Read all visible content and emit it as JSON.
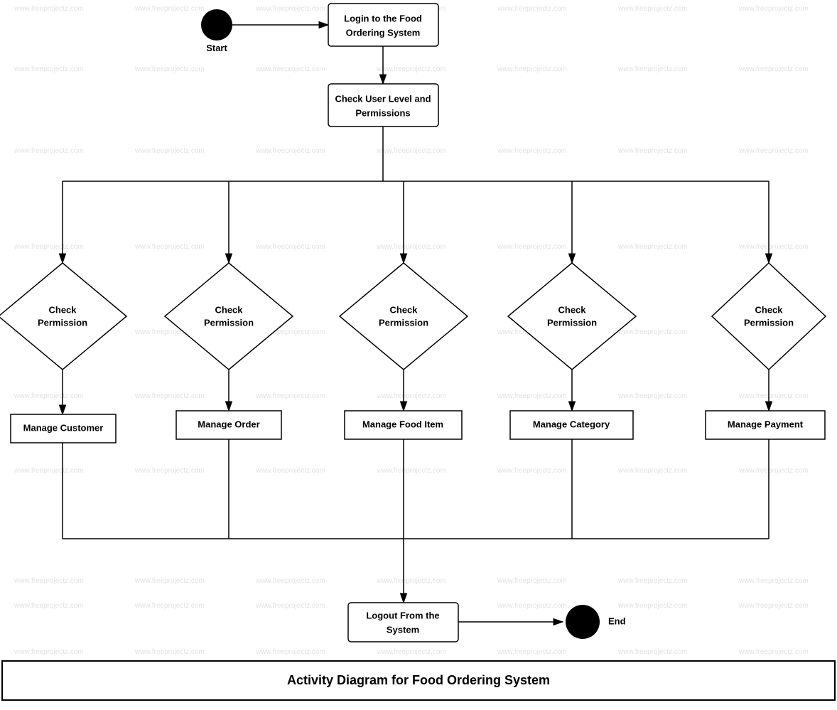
{
  "diagram": {
    "title": "Activity Diagram for Food Ordering System",
    "nodes": {
      "start": {
        "label": "Start"
      },
      "login": {
        "label": "Login to the Food\nOrdering System"
      },
      "checkPermissions": {
        "label": "Check User Level and\nPermissions"
      },
      "checkPerm1": {
        "label": "Check\nPermission"
      },
      "checkPerm2": {
        "label": "Check\nPermission"
      },
      "checkPerm3": {
        "label": "Check\nPermission"
      },
      "checkPerm4": {
        "label": "Check\nPermission"
      },
      "checkPerm5": {
        "label": "Check\nPermission"
      },
      "manageCustomer": {
        "label": "Manage Customer"
      },
      "manageOrder": {
        "label": "Manage Order"
      },
      "manageFoodItem": {
        "label": "Manage Food Item"
      },
      "manageCategory": {
        "label": "Manage Category"
      },
      "managePayment": {
        "label": "Manage Payment"
      },
      "logout": {
        "label": "Logout From the\nSystem"
      },
      "end": {
        "label": "End"
      }
    },
    "watermark": "www.freeprojectz.com"
  }
}
